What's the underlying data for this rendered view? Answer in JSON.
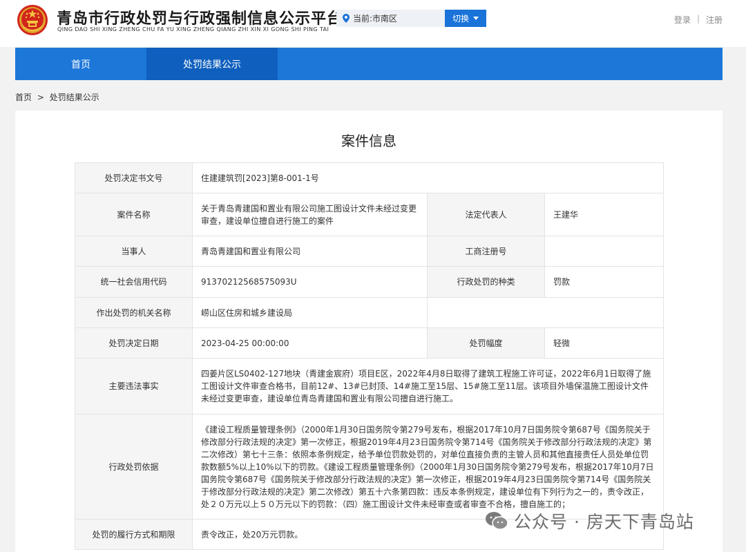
{
  "header": {
    "title": "青岛市行政处罚与行政强制信息公示平台",
    "subtitle": "QING DAO SHI XING ZHENG CHU FA YU XING ZHENG QIANG ZHI XIN XI GONG SHI PING TAI",
    "location_label": "当前:市南区",
    "switch_label": "切换",
    "login_label": "登录",
    "register_label": "注册",
    "separator": "|"
  },
  "nav": {
    "items": [
      {
        "label": "首页"
      },
      {
        "label": "处罚结果公示"
      }
    ]
  },
  "breadcrumb": {
    "home": "首页",
    "separator": ">",
    "current": "处罚结果公示"
  },
  "panel": {
    "title": "案件信息"
  },
  "case": {
    "doc_no_label": "处罚决定书文号",
    "doc_no": "住建建筑罚[2023]第8-001-1号",
    "case_name_label": "案件名称",
    "case_name": "关于青岛青建国和置业有限公司施工图设计文件未经过变更审查，建设单位擅自进行施工的案件",
    "legal_rep_label": "法定代表人",
    "legal_rep": "王建华",
    "party_label": "当事人",
    "party": "青岛青建国和置业有限公司",
    "biz_reg_label": "工商注册号",
    "biz_reg": "",
    "credit_code_label": "统一社会信用代码",
    "credit_code": "91370212568575093U",
    "penalty_type_label": "行政处罚的种类",
    "penalty_type": "罚款",
    "authority_label": "作出处罚的机关名称",
    "authority": "崂山区住房和城乡建设局",
    "decision_date_label": "处罚决定日期",
    "decision_date": "2023-04-25 00:00:00",
    "severity_label": "处罚幅度",
    "severity": "轻微",
    "facts_label": "主要违法事实",
    "facts": "四姜片区LS0402-127地块（青建金宸府）项目E区，2022年4月8日取得了建筑工程施工许可证，2022年6月1日取得了施工图设计文件审查合格书，目前12#、13#已封顶、14#施工至15层、15#施工至11层。该项目外墙保温施工图设计文件未经过变更审查，建设单位青岛青建国和置业有限公司擅自进行施工。",
    "basis_label": "行政处罚依据",
    "basis": "《建设工程质量管理条例》（2000年1月30日国务院令第279号发布，根据2017年10月7日国务院令第687号《国务院关于修改部分行政法规的决定》第一次修正，根据2019年4月23日国务院令第714号《国务院关于修改部分行政法规的决定》第二次修改）第七十三条：依照本条例规定，给予单位罚款处罚的，对单位直接负责的主管人员和其他直接责任人员处单位罚款数额5%以上10%以下的罚款。《建设工程质量管理条例》（2000年1月30日国务院令第279号发布，根据2017年10月7日国务院令第687号《国务院关于修改部分行政法规的决定》第一次修正，根据2019年4月23日国务院令第714号《国务院关于修改部分行政法规的决定》第二次修改）第五十六条第四款：违反本条例规定，建设单位有下列行为之一的，责令改正，处２０万元以上５０万元以下的罚款：（四）施工图设计文件未经审查或者审查不合格，擅自施工的；",
    "execution_label": "处罚的履行方式和期限",
    "execution": "责令改正，处20万元罚款。"
  },
  "watermark": {
    "text": "公众号 · 房天下青岛站",
    "icon": "wechat-icon"
  },
  "colors": {
    "nav_bg": "#1d77d9",
    "nav_active": "#0f5fbe",
    "switch_btn": "#1a73d9",
    "label_bg": "#f5f5f5"
  }
}
